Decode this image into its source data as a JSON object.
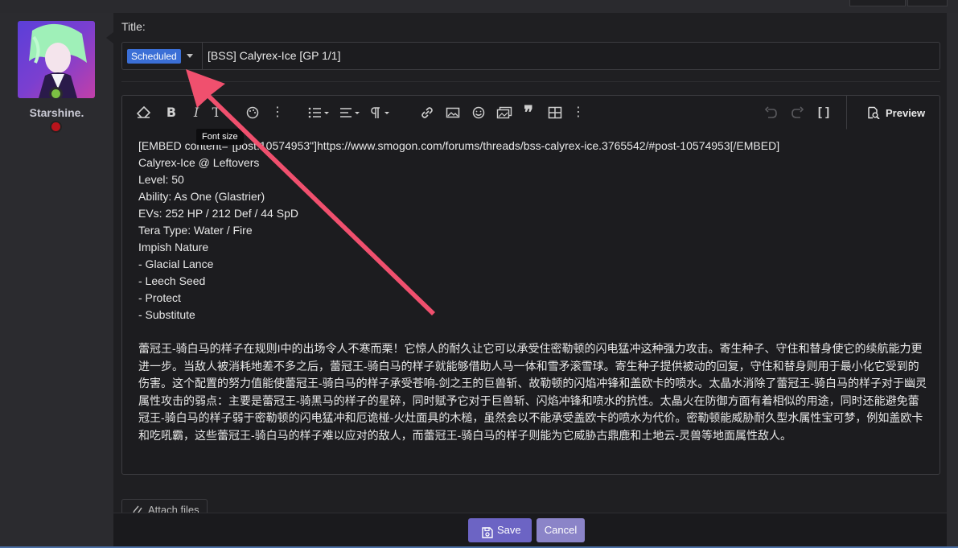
{
  "user": {
    "name": "Starshine."
  },
  "form": {
    "title_label": "Title:",
    "prefix": "Scheduled",
    "title_value": "[BSS] Calyrex-Ice [GP 1/1]"
  },
  "toolbar": {
    "preview_label": "Preview",
    "tooltip": "Font size",
    "icons": [
      "eraser-icon",
      "bold-icon",
      "italic-icon",
      "font-size-icon",
      "palette-icon",
      "more-icon",
      "list-icon",
      "align-icon",
      "paragraph-icon",
      "link-icon",
      "image-icon",
      "smilie-icon",
      "media-icon",
      "quote-icon",
      "table-icon",
      "more-icon",
      "undo-icon",
      "redo-icon",
      "bbcode-icon",
      "preview-icon"
    ]
  },
  "editor": {
    "lines": [
      "[EMBED content=\"[post:10574953\"]https://www.smogon.com/forums/threads/bss-calyrex-ice.3765542/#post-10574953[/EMBED]",
      "Calyrex-Ice @ Leftovers",
      "Level: 50",
      "Ability: As One (Glastrier)",
      "EVs: 252 HP / 212 Def / 44 SpD",
      "Tera Type: Water / Fire",
      "Impish Nature",
      "- Glacial Lance",
      "- Leech Seed",
      "- Protect",
      "- Substitute"
    ],
    "paragraph": "蕾冠王-骑白马的样子在规则I中的出场令人不寒而栗！它惊人的耐久让它可以承受住密勒顿的闪电猛冲这种强力攻击。寄生种子、守住和替身使它的续航能力更进一步。当敌人被消耗地差不多之后，蕾冠王-骑白马的样子就能够借助人马一体和雪矛滚雪球。寄生种子提供被动的回复，守住和替身则用于最小化它受到的伤害。这个配置的努力值能使蕾冠王-骑白马的样子承受苍响-剑之王的巨兽斩、故勒顿的闪焰冲锋和盖欧卡的喷水。太晶水消除了蕾冠王-骑白马的样子对于幽灵属性攻击的弱点：主要是蕾冠王-骑黑马的样子的星碎，同时赋予它对于巨兽斩、闪焰冲锋和喷水的抗性。太晶火在防御方面有着相似的用途，同时还能避免蕾冠王-骑白马的样子弱于密勒顿的闪电猛冲和厄诡椪-火灶面具的木槌，虽然会以不能承受盖欧卡的喷水为代价。密勒顿能威胁耐久型水属性宝可梦，例如盖欧卡和吃吼霸，这些蕾冠王-骑白马的样子难以应对的敌人，而蕾冠王-骑白马的样子则能为它威胁古鼎鹿和土地云-灵兽等地面属性敌人。"
  },
  "actions": {
    "attach_label": "Attach files",
    "save_label": "Save",
    "cancel_label": "Cancel"
  },
  "colors": {
    "accent": "#6c64c4",
    "prefix_chip": "#3b6fd6",
    "arrow": "#f0506e"
  }
}
